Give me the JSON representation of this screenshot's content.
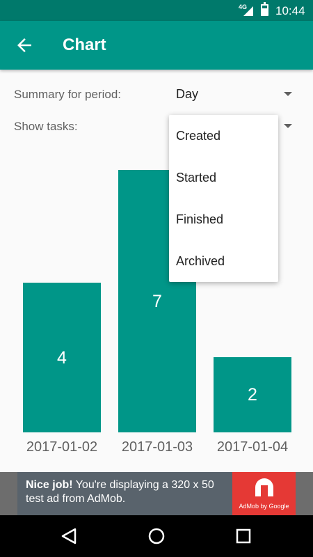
{
  "status_bar": {
    "network": "4G",
    "time": "10:44"
  },
  "app_bar": {
    "title": "Chart",
    "back_icon": "arrow-back-icon"
  },
  "filters": {
    "summary_label": "Summary for period:",
    "summary_value": "Day",
    "show_tasks_label": "Show tasks:"
  },
  "dropdown": {
    "options": [
      "Created",
      "Started",
      "Finished",
      "Archived"
    ]
  },
  "chart_data": {
    "type": "bar",
    "categories": [
      "2017-01-02",
      "2017-01-03",
      "2017-01-04"
    ],
    "values": [
      4,
      7,
      2
    ],
    "title": "",
    "xlabel": "",
    "ylabel": "",
    "ylim": [
      0,
      8
    ],
    "color": "#009688"
  },
  "ad": {
    "bold": "Nice job!",
    "text": " You're displaying a 320 x 50 test ad from AdMob.",
    "logo_caption": "AdMob by Google"
  },
  "colors": {
    "primary": "#009688",
    "primary_dark": "#00796b"
  }
}
